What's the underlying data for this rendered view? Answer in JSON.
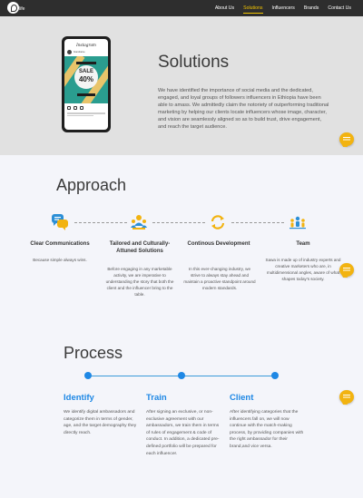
{
  "nav": {
    "logo_text": "life",
    "items": [
      {
        "label": "About Us",
        "active": false
      },
      {
        "label": "Solutions",
        "active": true
      },
      {
        "label": "Influencers",
        "active": false
      },
      {
        "label": "Brands",
        "active": false
      },
      {
        "label": "Contact Us",
        "active": false
      }
    ]
  },
  "hero": {
    "title": "Solutions",
    "text": "We have identified the importance of social media and the dedicated, engaged, and loyal groups of followers influencers in Ethiopia have been able to amass. We admittedly claim the notoriety of outperforming traditional marketing by helping our clients locate influencers whose image, character, and vision are seamlessly aligned so as to build trust, drive engagement, and reach the target audience.",
    "phone": {
      "app": "Instagram",
      "account": "brandname",
      "post_title": "SALE",
      "post_percent": "40%"
    }
  },
  "approach": {
    "title": "Approach",
    "items": [
      {
        "icon": "chat-bubbles-icon",
        "heading": "Clear Communications",
        "text": "Because simple always wins."
      },
      {
        "icon": "team-award-icon",
        "heading": "Tailored and Culturally-Attuned Solutions",
        "text": "Before engaging in any marketable activity, we are imperative to understanding the story that both the client and the influencer bring to the table."
      },
      {
        "icon": "refresh-cycle-icon",
        "heading": "Continous Development",
        "text": "In this ever-changing industry, we strive to always stay ahead and maintain a proactive standpoint around modern standards."
      },
      {
        "icon": "team-people-icon",
        "heading": "Team",
        "text": "Sawa is made up of industry experts and creative marketers who are, in multidimensional angles, aware of what shapes today's society."
      }
    ]
  },
  "process": {
    "title": "Process",
    "steps": [
      {
        "heading": "Identify",
        "text": "We identify digital ambassadors and categorize them in terms of gender, age, and the target demography they directly reach."
      },
      {
        "heading": "Train",
        "text": "After signing an exclusive, or non-exclusive agreement with our ambassadors, we train them in terms of rules of engagement & code of conduct. In addition, a dedicated pre-defined portfolio will be prepared for each influencer."
      },
      {
        "heading": "Client",
        "text": "After identifying categories that the influencers fall on, we will now continue with the match-making process, by providing companies with the right ambassador for their brand,and vice versa."
      }
    ]
  },
  "colors": {
    "nav_bg": "#2e2e2e",
    "nav_active": "#f2c400",
    "hero_bg": "#e1e1e1",
    "accent_blue": "#1e88e5",
    "chat_yellow": "#f2b310"
  },
  "chat_button_icon": "chat-icon"
}
